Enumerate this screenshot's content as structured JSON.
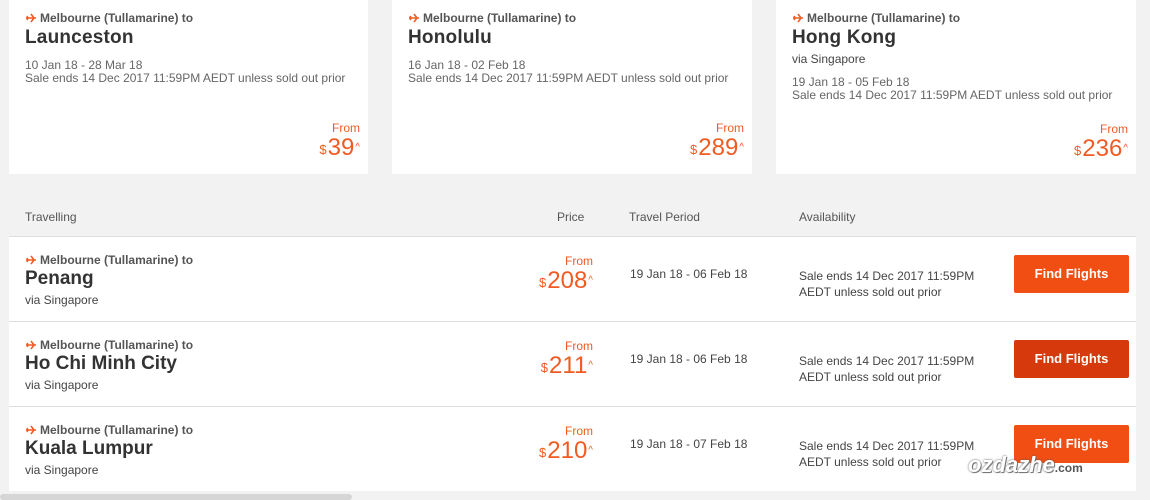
{
  "origin": "Melbourne (Tullamarine) to",
  "currency": "$",
  "from_label": "From",
  "caret": "^",
  "cards": [
    {
      "dest": "Launceston",
      "via": "",
      "dates": "10 Jan 18 - 28 Mar 18",
      "sale": "Sale ends 14 Dec 2017 11:59PM AEDT unless sold out prior",
      "price": "39"
    },
    {
      "dest": "Honolulu",
      "via": "",
      "dates": "16 Jan 18 - 02 Feb 18",
      "sale": "Sale ends 14 Dec 2017 11:59PM AEDT unless sold out prior",
      "price": "289"
    },
    {
      "dest": "Hong Kong",
      "via": "via Singapore",
      "dates": "19 Jan 18 - 05 Feb 18",
      "sale": "Sale ends 14 Dec 2017 11:59PM AEDT unless sold out prior",
      "price": "236"
    }
  ],
  "table": {
    "headers": {
      "travelling": "Travelling",
      "price": "Price",
      "period": "Travel Period",
      "availability": "Availability"
    },
    "rows": [
      {
        "dest": "Penang",
        "via": "via Singapore",
        "price": "208",
        "period": "19 Jan 18 - 06 Feb 18",
        "avail1": "Sale ends 14 Dec 2017 11:59PM",
        "avail2": "AEDT unless sold out prior",
        "button": "Find Flights"
      },
      {
        "dest": "Ho Chi Minh City",
        "via": "via Singapore",
        "price": "211",
        "period": "19 Jan 18 - 06 Feb 18",
        "avail1": "Sale ends 14 Dec 2017 11:59PM",
        "avail2": "AEDT unless sold out prior",
        "button": "Find Flights"
      },
      {
        "dest": "Kuala Lumpur",
        "via": "via Singapore",
        "price": "210",
        "period": "19 Jan 18 - 07 Feb 18",
        "avail1": "Sale ends 14 Dec 2017 11:59PM",
        "avail2": "AEDT unless sold out prior",
        "button": "Find Flights"
      }
    ]
  },
  "watermark": {
    "text": "ozdazhe",
    "suffix": ".com"
  },
  "colors": {
    "accent": "#f15b22",
    "button": "#f04e12",
    "button_hover": "#d63a0c",
    "background": "#f2f2f2"
  }
}
